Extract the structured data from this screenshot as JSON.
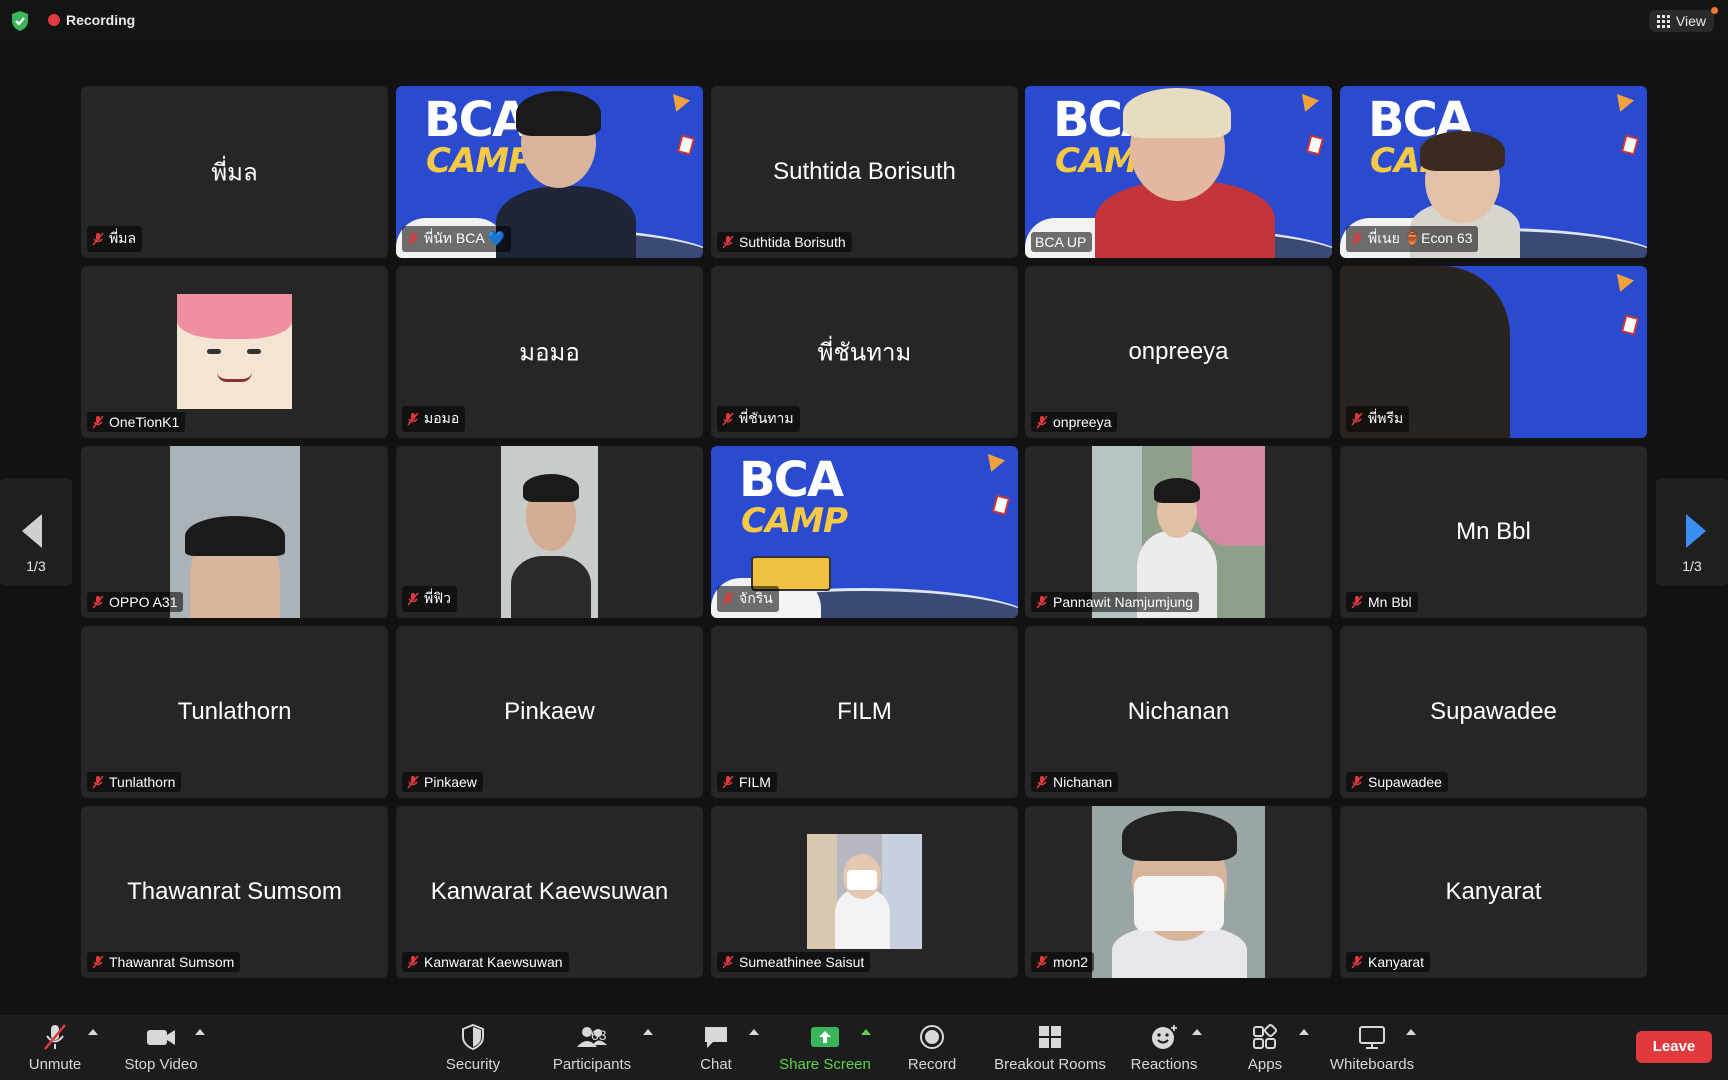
{
  "topbar": {
    "recording_label": "Recording",
    "view_label": "View"
  },
  "tiles": [
    {
      "big": "พี่มล",
      "label": "พี่มล",
      "kind": "name"
    },
    {
      "big": "",
      "label": "พี่นัท BCA 💙",
      "kind": "bca-person"
    },
    {
      "big": "Suthtida Borisuth",
      "label": "Suthtida Borisuth",
      "kind": "name"
    },
    {
      "big": "",
      "label": "BCA UP",
      "kind": "bca-person",
      "active": true
    },
    {
      "big": "",
      "label": "พี่เนย 🏺Econ 63",
      "kind": "bca-person"
    },
    {
      "big": "",
      "label": "OneTionK1",
      "kind": "avatar"
    },
    {
      "big": "มอมอ",
      "label": "มอมอ",
      "kind": "name"
    },
    {
      "big": "พี่ชันทาม",
      "label": "พี่ชันทาม",
      "kind": "name"
    },
    {
      "big": "onpreeya",
      "label": "onpreeya",
      "kind": "name"
    },
    {
      "big": "",
      "label": "พี่พรีม",
      "kind": "bca-side"
    },
    {
      "big": "",
      "label": "OPPO A31",
      "kind": "photo"
    },
    {
      "big": "",
      "label": "พี่ฟิว",
      "kind": "photo"
    },
    {
      "big": "",
      "label": "จักริน",
      "kind": "bca"
    },
    {
      "big": "",
      "label": "Pannawit Namjumjung",
      "kind": "photo"
    },
    {
      "big": "Mn Bbl",
      "label": "Mn Bbl",
      "kind": "name"
    },
    {
      "big": "Tunlathorn",
      "label": "Tunlathorn",
      "kind": "name"
    },
    {
      "big": "Pinkaew",
      "label": "Pinkaew",
      "kind": "name"
    },
    {
      "big": "FILM",
      "label": "FILM",
      "kind": "name"
    },
    {
      "big": "Nichanan",
      "label": "Nichanan",
      "kind": "name"
    },
    {
      "big": "Supawadee",
      "label": "Supawadee",
      "kind": "name"
    },
    {
      "big": "Thawanrat Sumsom",
      "label": "Thawanrat Sumsom",
      "kind": "name"
    },
    {
      "big": "Kanwarat Kaewsuwan",
      "label": "Kanwarat Kaewsuwan",
      "kind": "name"
    },
    {
      "big": "",
      "label": "Sumeathinee Saisut",
      "kind": "photo-small"
    },
    {
      "big": "",
      "label": "mon2",
      "kind": "photo"
    },
    {
      "big": "Kanyarat",
      "label": "Kanyarat",
      "kind": "name"
    }
  ],
  "pager": {
    "left": "1/3",
    "right": "1/3"
  },
  "toolbar": {
    "unmute": "Unmute",
    "stop_video": "Stop Video",
    "security": "Security",
    "participants": "Participants",
    "participants_count": "63",
    "chat": "Chat",
    "share_screen": "Share Screen",
    "record": "Record",
    "breakout_rooms": "Breakout Rooms",
    "reactions": "Reactions",
    "apps": "Apps",
    "whiteboards": "Whiteboards",
    "leave": "Leave"
  },
  "colors": {
    "recording": "#e0393e",
    "active_speaker": "#5fd14a",
    "share": "#5fd14a",
    "leave": "#e0393e",
    "bca_bg": "#2a4bd0"
  }
}
